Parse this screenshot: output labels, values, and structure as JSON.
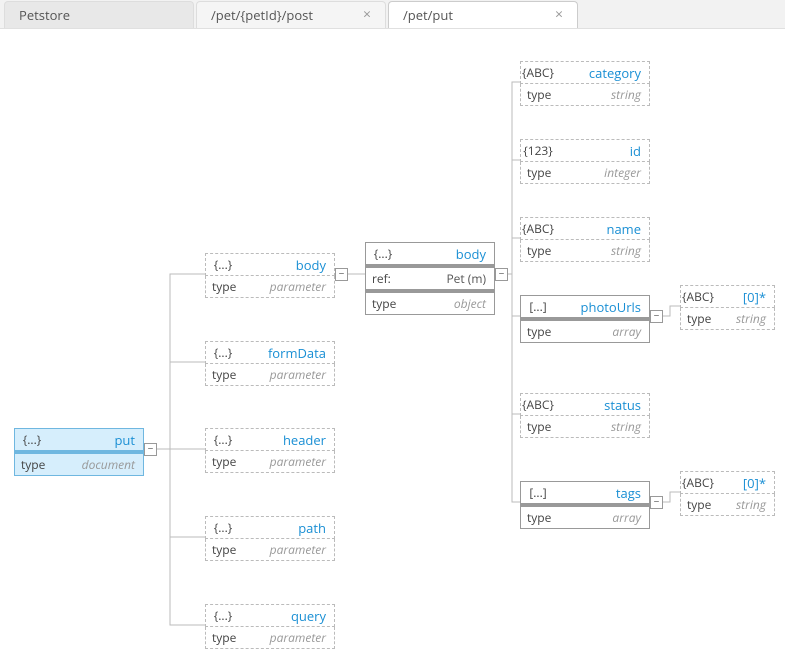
{
  "tabs": {
    "root": "Petstore",
    "inactive": "/pet/{petId}/post",
    "active": "/pet/put"
  },
  "label": {
    "type": "type",
    "ref": "ref:"
  },
  "root": {
    "icon": "{...}",
    "name": "put",
    "type": "document"
  },
  "params": [
    {
      "icon": "{...}",
      "name": "body",
      "type": "parameter"
    },
    {
      "icon": "{...}",
      "name": "formData",
      "type": "parameter"
    },
    {
      "icon": "{...}",
      "name": "header",
      "type": "parameter"
    },
    {
      "icon": "{...}",
      "name": "path",
      "type": "parameter"
    },
    {
      "icon": "{...}",
      "name": "query",
      "type": "parameter"
    }
  ],
  "body": {
    "icon": "{...}",
    "name": "body",
    "ref": "Pet (m)",
    "type": "object"
  },
  "fields": [
    {
      "icon": "{ABC}",
      "name": "category",
      "type": "string"
    },
    {
      "icon": "{123}",
      "name": "id",
      "type": "integer"
    },
    {
      "icon": "{ABC}",
      "name": "name",
      "type": "string"
    },
    {
      "icon": "[...]",
      "name": "photoUrls",
      "type": "array"
    },
    {
      "icon": "{ABC}",
      "name": "status",
      "type": "string"
    },
    {
      "icon": "[...]",
      "name": "tags",
      "type": "array"
    }
  ],
  "leaf": [
    {
      "icon": "{ABC}",
      "name": "[0]*",
      "type": "string"
    },
    {
      "icon": "{ABC}",
      "name": "[0]*",
      "type": "string"
    }
  ]
}
